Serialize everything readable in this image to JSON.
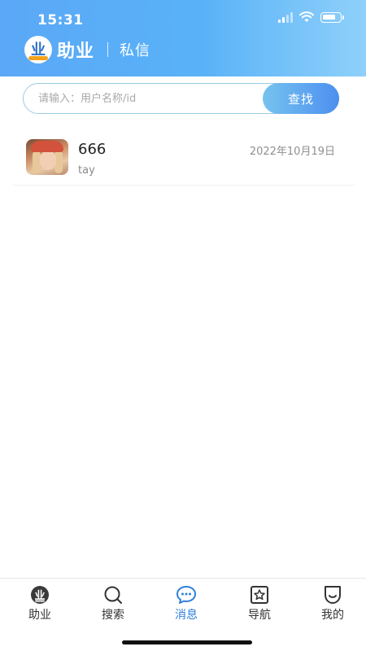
{
  "status_bar": {
    "time": "15:31",
    "battery_level": 0.8,
    "icons": [
      "signal-icon",
      "wifi-icon",
      "battery-icon"
    ]
  },
  "header": {
    "logo_mark": "业",
    "brand": "助业",
    "title": "私信"
  },
  "search": {
    "placeholder": "请输入：用户名称/id",
    "value": "",
    "button_label": "查找"
  },
  "messages": [
    {
      "name": "666",
      "preview": "tay",
      "date": "2022年10月19日"
    }
  ],
  "tabbar": {
    "active": "消息",
    "items": [
      {
        "label": "助业",
        "icon": "zhuye-logo-icon"
      },
      {
        "label": "搜索",
        "icon": "search-icon"
      },
      {
        "label": "消息",
        "icon": "message-icon"
      },
      {
        "label": "导航",
        "icon": "star-box-icon"
      },
      {
        "label": "我的",
        "icon": "smile-icon"
      }
    ]
  },
  "colors": {
    "header_start": "#5aa8f7",
    "header_end": "#8fd0fb",
    "accent": "#2f7fdc",
    "button_start": "#76c3ef",
    "button_end": "#4c8ff0"
  }
}
